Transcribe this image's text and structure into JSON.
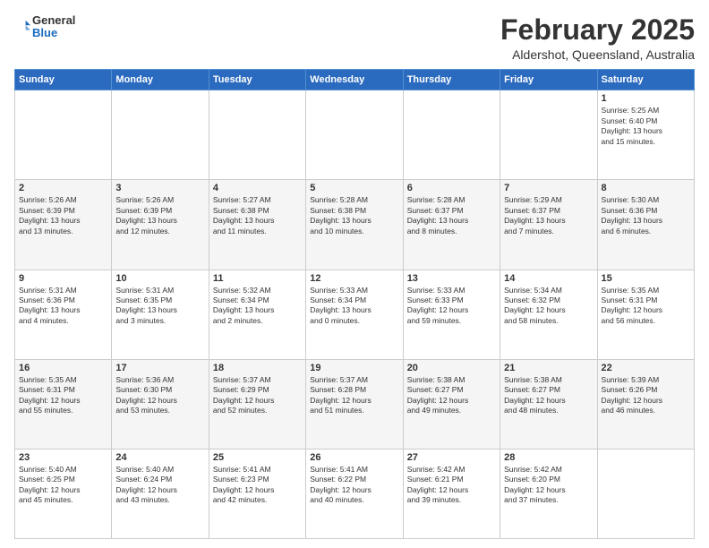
{
  "header": {
    "logo": {
      "line1": "General",
      "line2": "Blue"
    },
    "title": "February 2025",
    "location": "Aldershot, Queensland, Australia"
  },
  "weekdays": [
    "Sunday",
    "Monday",
    "Tuesday",
    "Wednesday",
    "Thursday",
    "Friday",
    "Saturday"
  ],
  "weeks": [
    [
      {
        "day": "",
        "info": ""
      },
      {
        "day": "",
        "info": ""
      },
      {
        "day": "",
        "info": ""
      },
      {
        "day": "",
        "info": ""
      },
      {
        "day": "",
        "info": ""
      },
      {
        "day": "",
        "info": ""
      },
      {
        "day": "1",
        "info": "Sunrise: 5:25 AM\nSunset: 6:40 PM\nDaylight: 13 hours\nand 15 minutes."
      }
    ],
    [
      {
        "day": "2",
        "info": "Sunrise: 5:26 AM\nSunset: 6:39 PM\nDaylight: 13 hours\nand 13 minutes."
      },
      {
        "day": "3",
        "info": "Sunrise: 5:26 AM\nSunset: 6:39 PM\nDaylight: 13 hours\nand 12 minutes."
      },
      {
        "day": "4",
        "info": "Sunrise: 5:27 AM\nSunset: 6:38 PM\nDaylight: 13 hours\nand 11 minutes."
      },
      {
        "day": "5",
        "info": "Sunrise: 5:28 AM\nSunset: 6:38 PM\nDaylight: 13 hours\nand 10 minutes."
      },
      {
        "day": "6",
        "info": "Sunrise: 5:28 AM\nSunset: 6:37 PM\nDaylight: 13 hours\nand 8 minutes."
      },
      {
        "day": "7",
        "info": "Sunrise: 5:29 AM\nSunset: 6:37 PM\nDaylight: 13 hours\nand 7 minutes."
      },
      {
        "day": "8",
        "info": "Sunrise: 5:30 AM\nSunset: 6:36 PM\nDaylight: 13 hours\nand 6 minutes."
      }
    ],
    [
      {
        "day": "9",
        "info": "Sunrise: 5:31 AM\nSunset: 6:36 PM\nDaylight: 13 hours\nand 4 minutes."
      },
      {
        "day": "10",
        "info": "Sunrise: 5:31 AM\nSunset: 6:35 PM\nDaylight: 13 hours\nand 3 minutes."
      },
      {
        "day": "11",
        "info": "Sunrise: 5:32 AM\nSunset: 6:34 PM\nDaylight: 13 hours\nand 2 minutes."
      },
      {
        "day": "12",
        "info": "Sunrise: 5:33 AM\nSunset: 6:34 PM\nDaylight: 13 hours\nand 0 minutes."
      },
      {
        "day": "13",
        "info": "Sunrise: 5:33 AM\nSunset: 6:33 PM\nDaylight: 12 hours\nand 59 minutes."
      },
      {
        "day": "14",
        "info": "Sunrise: 5:34 AM\nSunset: 6:32 PM\nDaylight: 12 hours\nand 58 minutes."
      },
      {
        "day": "15",
        "info": "Sunrise: 5:35 AM\nSunset: 6:31 PM\nDaylight: 12 hours\nand 56 minutes."
      }
    ],
    [
      {
        "day": "16",
        "info": "Sunrise: 5:35 AM\nSunset: 6:31 PM\nDaylight: 12 hours\nand 55 minutes."
      },
      {
        "day": "17",
        "info": "Sunrise: 5:36 AM\nSunset: 6:30 PM\nDaylight: 12 hours\nand 53 minutes."
      },
      {
        "day": "18",
        "info": "Sunrise: 5:37 AM\nSunset: 6:29 PM\nDaylight: 12 hours\nand 52 minutes."
      },
      {
        "day": "19",
        "info": "Sunrise: 5:37 AM\nSunset: 6:28 PM\nDaylight: 12 hours\nand 51 minutes."
      },
      {
        "day": "20",
        "info": "Sunrise: 5:38 AM\nSunset: 6:27 PM\nDaylight: 12 hours\nand 49 minutes."
      },
      {
        "day": "21",
        "info": "Sunrise: 5:38 AM\nSunset: 6:27 PM\nDaylight: 12 hours\nand 48 minutes."
      },
      {
        "day": "22",
        "info": "Sunrise: 5:39 AM\nSunset: 6:26 PM\nDaylight: 12 hours\nand 46 minutes."
      }
    ],
    [
      {
        "day": "23",
        "info": "Sunrise: 5:40 AM\nSunset: 6:25 PM\nDaylight: 12 hours\nand 45 minutes."
      },
      {
        "day": "24",
        "info": "Sunrise: 5:40 AM\nSunset: 6:24 PM\nDaylight: 12 hours\nand 43 minutes."
      },
      {
        "day": "25",
        "info": "Sunrise: 5:41 AM\nSunset: 6:23 PM\nDaylight: 12 hours\nand 42 minutes."
      },
      {
        "day": "26",
        "info": "Sunrise: 5:41 AM\nSunset: 6:22 PM\nDaylight: 12 hours\nand 40 minutes."
      },
      {
        "day": "27",
        "info": "Sunrise: 5:42 AM\nSunset: 6:21 PM\nDaylight: 12 hours\nand 39 minutes."
      },
      {
        "day": "28",
        "info": "Sunrise: 5:42 AM\nSunset: 6:20 PM\nDaylight: 12 hours\nand 37 minutes."
      },
      {
        "day": "",
        "info": ""
      }
    ]
  ]
}
